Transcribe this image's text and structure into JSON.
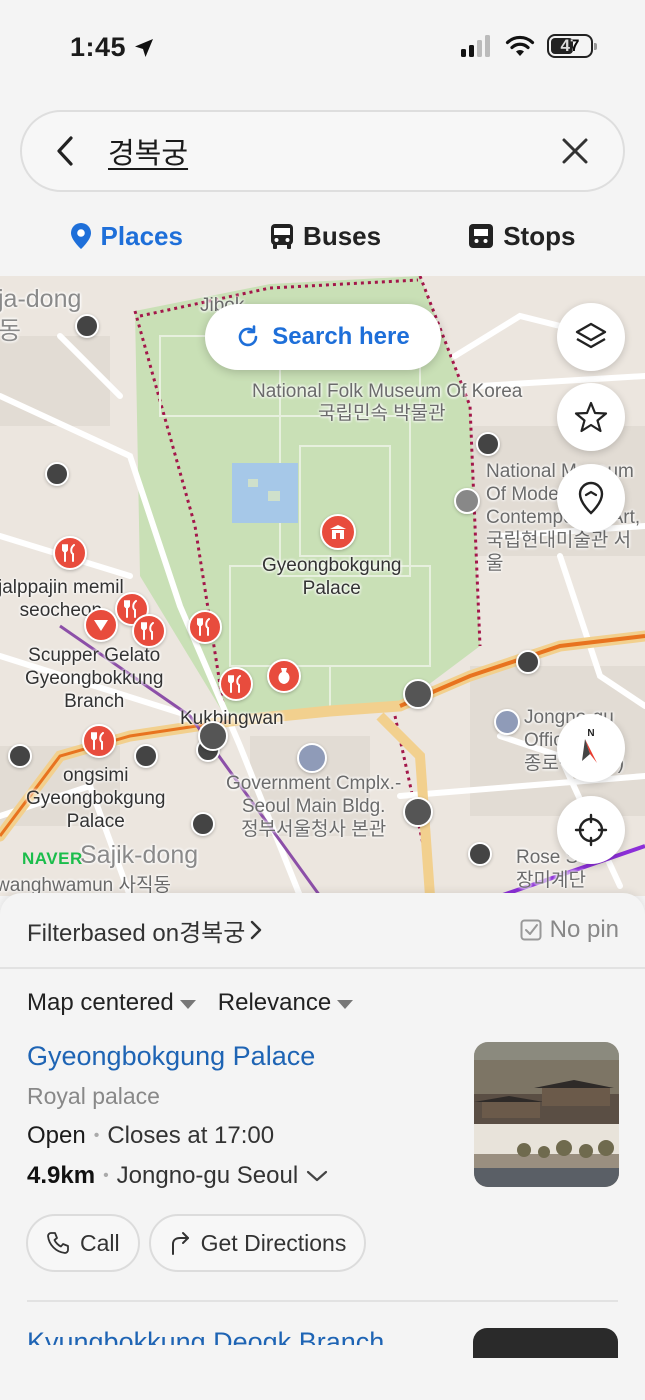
{
  "status_bar": {
    "time": "1:45",
    "battery": "47"
  },
  "search": {
    "query": "경복궁"
  },
  "tabs": [
    {
      "label": "Places",
      "active": true
    },
    {
      "label": "Buses",
      "active": false
    },
    {
      "label": "Stops",
      "active": false
    }
  ],
  "map": {
    "search_here_label": "Search here",
    "labels": {
      "district_top_left": "ja-dong",
      "district_top_left_ko": "동",
      "jibok": "Jibok",
      "folk_museum": "National Folk Museum Of Korea",
      "folk_museum_ko": "국립민속 박물관",
      "palace": "Gyeongbokgung\nPalace",
      "modern_museum": "National Museum\nOf Modern and\nContemporary Art,\n국립현대미술관 서울",
      "jalppajin": "jalppajin memil\nseocheon",
      "scupper": "Scupper Gelato\nGyeongbokkung\nBranch",
      "kukbingwan": "Kukbingwan",
      "ongsimi": "ongsimi\nGyeongbokgung\nPalace",
      "govt": "Government Cmplx.-\nSeoul Main Bldg.\n정부서울청사 본관",
      "jongno": "Jongno-gu Office\n종로구청(시)",
      "sajik": "Sajik-dong",
      "gwanghwamun": "wanghwamun 사직동",
      "rose": "Rose S\n장미계단",
      "naver": "NAVER"
    }
  },
  "sheet": {
    "filter_label": "Filterbased on경복궁",
    "no_pin_label": "No pin",
    "sort_center": "Map centered",
    "sort_relevance": "Relevance",
    "result": {
      "title": "Gyeongbokgung Palace",
      "category": "Royal palace",
      "status": "Open",
      "hours": "Closes at 17:00",
      "distance": "4.9km",
      "area": "Jongno-gu Seoul"
    },
    "call_label": "Call",
    "directions_label": "Get Directions",
    "next_title": "Kyungbokkung Deogk Branch"
  },
  "colors": {
    "accent": "#1e6fd9",
    "link": "#1e64b4",
    "poi": "#e84c3d",
    "park": "#c7dfb4",
    "naver": "#1bbd4b"
  }
}
